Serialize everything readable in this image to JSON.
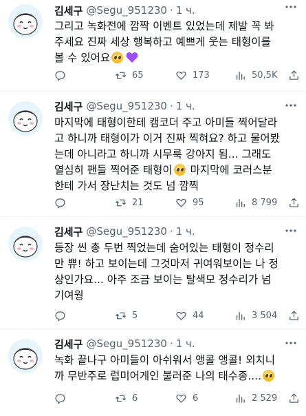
{
  "tweets": [
    {
      "author": {
        "name": "김세구",
        "handle": "@Segu_951230",
        "time": "1 ч."
      },
      "lines": [
        "그리고 녹화전에 깜짝 이벤트 있었는데 제발 꼭 봐",
        "주세요 진짜 세상 행복하고 예쁘게 웃는 태형이를",
        "볼 수 있어요"
      ],
      "line_emojis": [
        "pleading-face",
        "purple-heart"
      ],
      "stats": {
        "reply": "",
        "retweet": "65",
        "like": "173",
        "views": "50,5K"
      }
    },
    {
      "author": {
        "name": "김세구",
        "handle": "@Segu_951230",
        "time": "1 ч."
      },
      "lines": [
        "마지막에 태형이한테 캠코더 주고 아미들 찍어달라",
        "고 하니까 태형이가 이거 진짜 찍혀요? 하고 물어봤",
        "는데 아니라고 하니까 시무룩 강아지 됨... 그래도",
        "열심히 팬들 찍어준 태형이",
        "한테 가서 장난치는 것도 넘 깜찍"
      ],
      "line4_tail": "마지막에 코러스분",
      "line_emojis": [
        "pleading-face"
      ],
      "stats": {
        "reply": "",
        "retweet": "21",
        "like": "95",
        "views": "8 799"
      }
    },
    {
      "author": {
        "name": "김세구",
        "handle": "@Segu_951230",
        "time": "1 ч."
      },
      "lines": [
        "등장 씬 총 두번 찍었는데 숨어있는 태형이 정수리",
        "만 쀼! 하고 보이는데 그것마저 귀여워보이는 나 정",
        "상인가요... 아주 조금 보이는 탈색모 정수리가 넘",
        "기여웡"
      ],
      "stats": {
        "reply": "",
        "retweet": "5",
        "like": "44",
        "views": "3 504"
      }
    },
    {
      "author": {
        "name": "김세구",
        "handle": "@Segu_951230",
        "time": "1 ч."
      },
      "lines": [
        "녹화 끝나구 아미들이 아쉬워서 앵콜 앵콜! 외치니",
        "까 무반주로 럽미어게인 불러준 나의 태수종...."
      ],
      "line_emojis": [
        "pleading-face"
      ],
      "stats": {
        "reply": "",
        "retweet": "6",
        "like": "6",
        "views": "2 529"
      }
    }
  ],
  "icons": {
    "avatar": "cartoon-face-avatar",
    "more": "more-options-icon",
    "reply": "reply-icon",
    "retweet": "retweet-icon",
    "like": "like-icon",
    "views": "views-icon",
    "share": "share-icon",
    "emoji_pleading": "pleading-face-emoji",
    "emoji_heart": "purple-heart-emoji"
  },
  "colors": {
    "text": "#0f1419",
    "secondary": "#536471",
    "divider": "#eff3f4",
    "heart": "#9b4dff"
  }
}
